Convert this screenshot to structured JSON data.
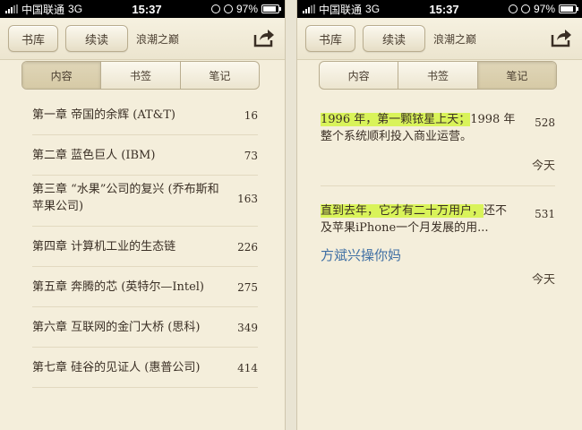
{
  "status": {
    "carrier": "中国联通",
    "network": "3G",
    "time": "15:37",
    "battery": "97%"
  },
  "navbar": {
    "library_label": "书库",
    "continue_label": "续读",
    "book_title": "浪潮之巅"
  },
  "tabs": [
    {
      "label": "内容"
    },
    {
      "label": "书签"
    },
    {
      "label": "笔记"
    }
  ],
  "toc": [
    {
      "title": "第一章  帝国的余辉 (AT&T)",
      "page": "16"
    },
    {
      "title": "第二章  蓝色巨人 (IBM)",
      "page": "73"
    },
    {
      "title": "第三章  “水果”公司的复兴 (乔布斯和苹果公司)",
      "page": "163"
    },
    {
      "title": "第四章  计算机工业的生态链",
      "page": "226"
    },
    {
      "title": "第五章  奔腾的芯 (英特尔—Intel)",
      "page": "275"
    },
    {
      "title": "第六章  互联网的金门大桥 (思科)",
      "page": "349"
    },
    {
      "title": "第七章  硅谷的见证人 (惠普公司)",
      "page": "414"
    }
  ],
  "notes": [
    {
      "highlight": "1996 年，第一颗铱星上天；",
      "rest": "1998 年整个系统顺利投入商业运营。",
      "page": "528",
      "comment": "",
      "date": "今天"
    },
    {
      "highlight": "直到去年，它才有二十万用户，",
      "rest": "还不及苹果iPhone一个月发展的用...",
      "page": "531",
      "comment": "方斌兴操你妈",
      "date": "今天"
    }
  ],
  "colors": {
    "highlight": "#d9f35a",
    "comment": "#3f6fa4",
    "paper": "#f4eedb"
  }
}
